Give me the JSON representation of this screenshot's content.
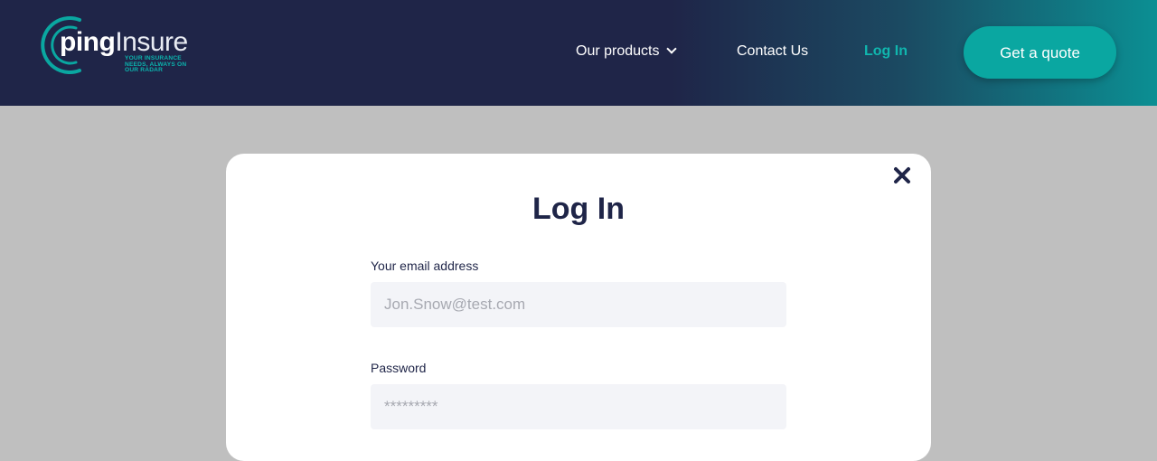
{
  "brand": {
    "name_bold": "ping",
    "name_light": "Insure",
    "tagline": "YOUR INSURANCE\nNEEDS, ALWAYS ON\nOUR RADAR",
    "colors": {
      "navy": "#1f2548",
      "teal": "#0aa7a1",
      "teal_light": "#10b6ae"
    }
  },
  "nav": {
    "products_label": "Our products",
    "products_icon": "chevron-down-icon",
    "contact_label": "Contact Us",
    "login_label": "Log In",
    "quote_label": "Get a quote"
  },
  "modal": {
    "close_icon": "close-icon",
    "title": "Log In",
    "email": {
      "label": "Your email address",
      "placeholder": "Jon.Snow@test.com",
      "value": ""
    },
    "password": {
      "label": "Password",
      "placeholder": "*********",
      "value": ""
    }
  }
}
